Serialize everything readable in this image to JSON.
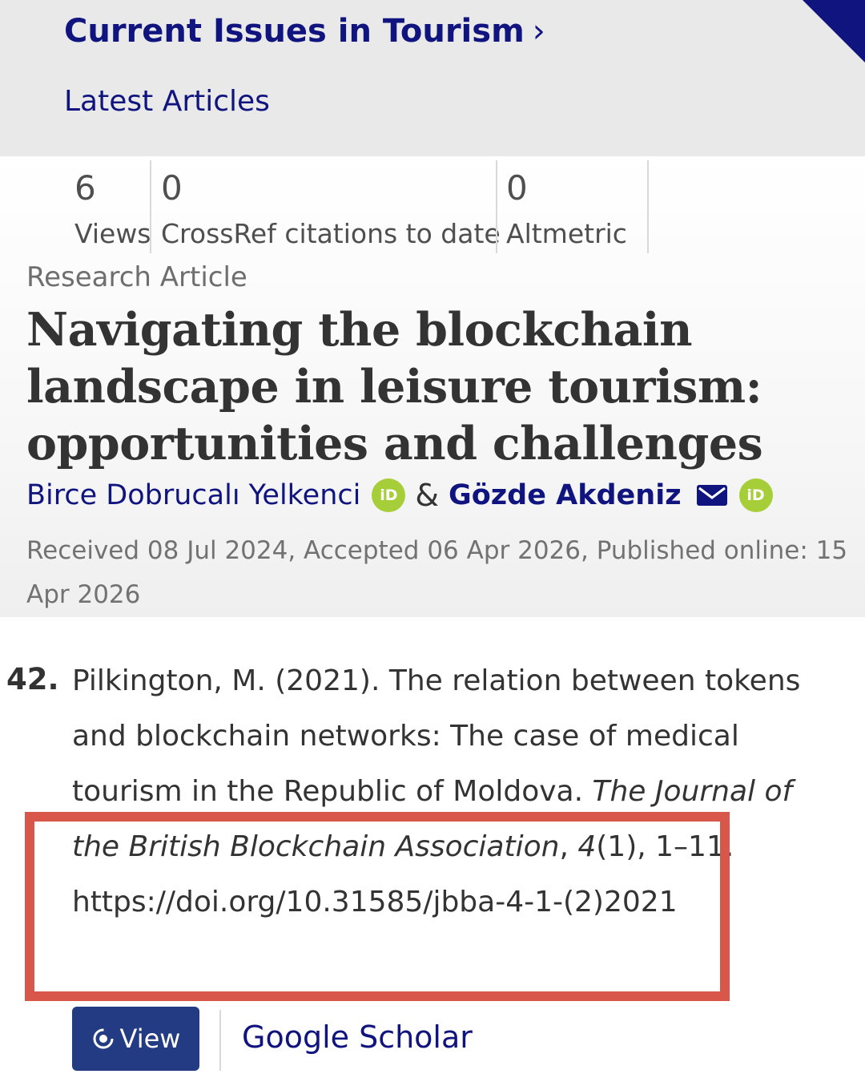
{
  "journal": {
    "title": "Current Issues in Tourism",
    "chevron": "›",
    "latest_articles": "Latest Articles"
  },
  "metrics": [
    {
      "value": "6",
      "label": "Views"
    },
    {
      "value": "0",
      "label": "CrossRef citations to date"
    },
    {
      "value": "0",
      "label": "Altmetric"
    }
  ],
  "article": {
    "type": "Research Article",
    "title": "Navigating the blockchain landscape in leisure tourism: opportunities and challenges",
    "authors": [
      {
        "name": "Birce Dobrucalı Yelkenci",
        "orcid_icon": "orcid-icon",
        "orcid_label": "iD"
      },
      {
        "name": "Gözde Akdeniz",
        "email_icon": "envelope-icon",
        "orcid_icon": "orcid-icon",
        "orcid_label": "iD"
      }
    ],
    "author_separator": "&",
    "dates": "Received 08 Jul 2024, Accepted 06 Apr 2026, Published online: 15 Apr 2026"
  },
  "reference": {
    "number": "42.",
    "text_before": "Pilkington, M. (2021). The relation between tokens and blockchain networks: The case of medical tourism in the Republic of Moldova.",
    "journal": "The Journal of the British Blockchain Association",
    "separator": ",",
    "volume": "4",
    "issue_pages": "(1), 1–11.",
    "doi": "https://doi.org/10.31585/jbba-4-1-(2)2021"
  },
  "actions": {
    "view_label": "View",
    "google_scholar_label": "Google Scholar"
  },
  "colors": {
    "brand_navy": "#10147e",
    "header_gray": "#e9e9ea",
    "orcid_green": "#a6ce39",
    "highlight_red": "#d9574a",
    "button_blue": "#223b82"
  }
}
